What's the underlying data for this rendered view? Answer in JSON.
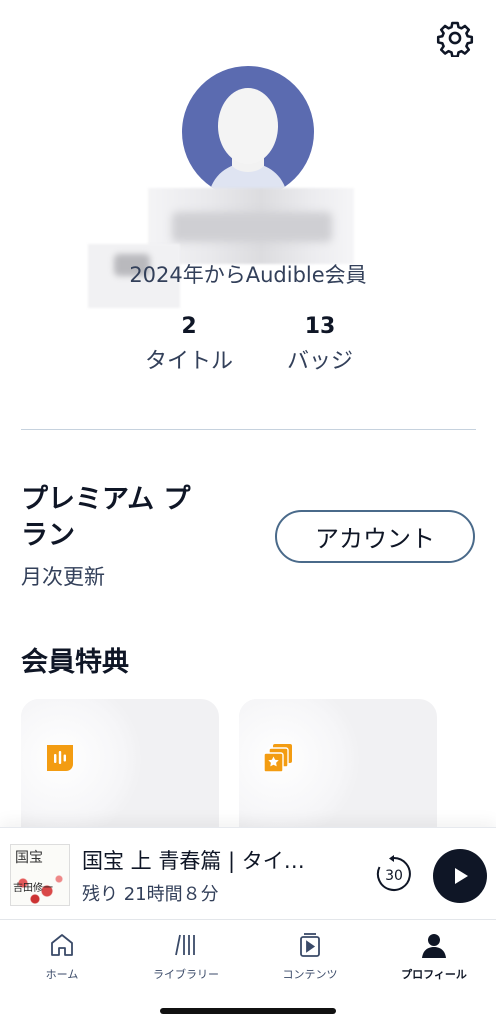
{
  "profile": {
    "member_since": "2024年からAudible会員",
    "stats": [
      {
        "value": "2",
        "label": "タイトル"
      },
      {
        "value": "13",
        "label": "バッジ"
      }
    ]
  },
  "plan": {
    "title": "プレミアム プラン",
    "billing": "月次更新",
    "account_button": "アカウント"
  },
  "benefits": {
    "title": "会員特典",
    "cards": [
      {
        "icon": "audio-waveform-icon"
      },
      {
        "icon": "star-collection-icon"
      }
    ]
  },
  "now_playing": {
    "title": "国宝 上 青春篇 | タイ…",
    "remaining": "残り 21時間８分",
    "rewind_seconds": "30",
    "cover": {
      "title": "国宝",
      "author": "吉田修一"
    }
  },
  "tabs": [
    {
      "label": "ホーム",
      "icon": "home-icon"
    },
    {
      "label": "ライブラリー",
      "icon": "library-icon"
    },
    {
      "label": "コンテンツ",
      "icon": "content-icon"
    },
    {
      "label": "プロフィール",
      "icon": "profile-icon",
      "active": true
    }
  ],
  "colors": {
    "accent": "#f39c12",
    "dark": "#0f1626",
    "avatar": "#5b6bb0"
  }
}
